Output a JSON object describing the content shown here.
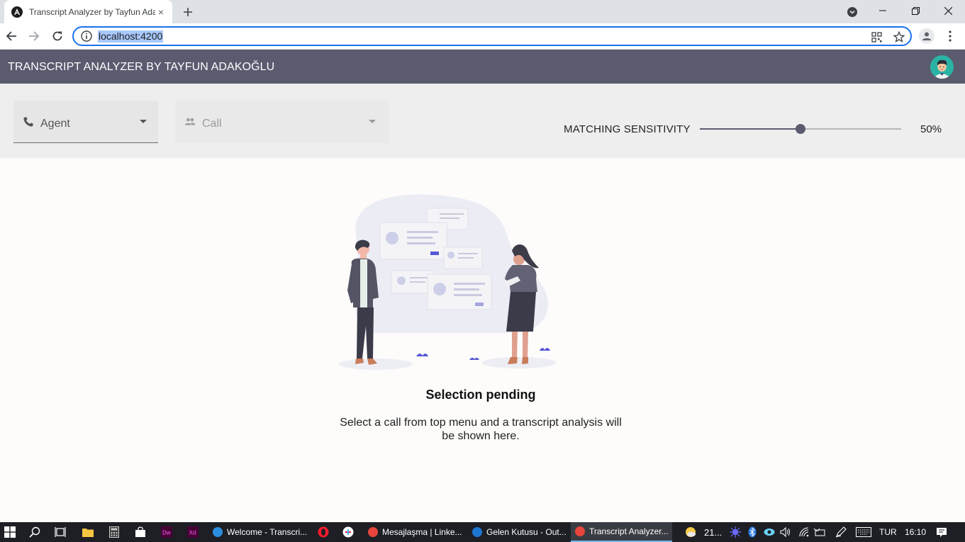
{
  "browser": {
    "tab_title": "Transcript Analyzer by Tayfun Adakoğlu",
    "tab_close_glyph": "×",
    "url": "localhost:4200"
  },
  "app": {
    "title": "TRANSCRIPT ANALYZER BY TAYFUN ADAKOĞLU"
  },
  "controls": {
    "agent_label": "Agent",
    "call_label": "Call",
    "sensitivity_label": "MATCHING SENSITIVITY",
    "sensitivity_value": 0.5,
    "sensitivity_text": "50%"
  },
  "empty_state": {
    "title": "Selection pending",
    "text": "Select a call from top menu and a transcript analysis will be shown here."
  },
  "taskbar": {
    "apps": [
      {
        "label": "Welcome - Transcri...",
        "color": "#2c8ee0"
      },
      {
        "label": "Mesajlaşma | Linke...",
        "color": "#e8453c"
      },
      {
        "label": "Gelen Kutusu - Out...",
        "color": "#1e76d2"
      },
      {
        "label": "Transcript Analyzer...",
        "color": "#e8453c"
      }
    ],
    "weather": "21...",
    "lang": "TUR",
    "time": "16:10"
  },
  "colors": {
    "accent": "#5a5b6f",
    "focus_blue": "#1a73e8"
  }
}
